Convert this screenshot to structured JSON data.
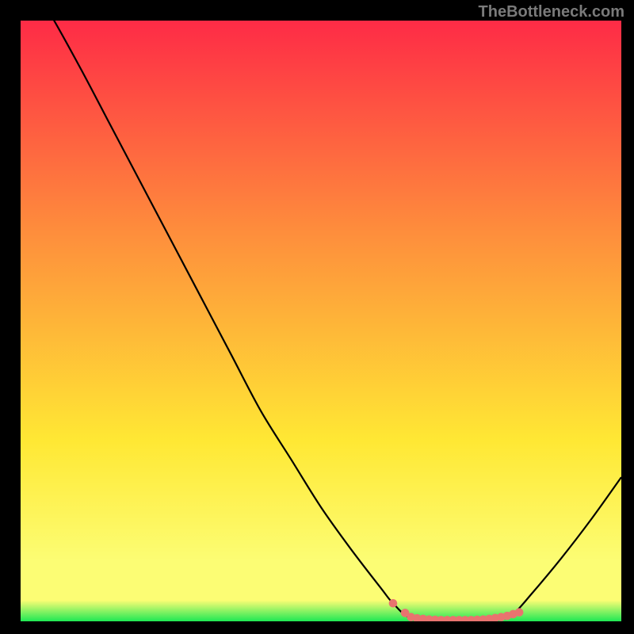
{
  "watermark": "TheBottleneck.com",
  "chart_data": {
    "type": "line",
    "title": "",
    "xlabel": "",
    "ylabel": "",
    "xlim": [
      0,
      100
    ],
    "ylim": [
      0,
      100
    ],
    "grid": false,
    "series": [
      {
        "name": "curve",
        "x": [
          0,
          5,
          10,
          15,
          20,
          25,
          30,
          35,
          40,
          45,
          50,
          55,
          60,
          62,
          65,
          70,
          75,
          80,
          82,
          85,
          90,
          95,
          100
        ],
        "y": [
          109,
          101,
          92,
          82.5,
          73,
          63.5,
          54,
          44.5,
          35,
          27,
          19,
          12,
          5.5,
          3,
          0.5,
          0.2,
          0.2,
          0.5,
          1.2,
          4.5,
          10.5,
          17,
          24
        ]
      }
    ],
    "markers": {
      "name": "optimal-band",
      "x": [
        62,
        64,
        65,
        66,
        67,
        68,
        69,
        70,
        71,
        72,
        73,
        74,
        75,
        76,
        77,
        78,
        79,
        80,
        81,
        82,
        83
      ],
      "y": [
        3,
        1.4,
        0.7,
        0.5,
        0.4,
        0.3,
        0.25,
        0.2,
        0.2,
        0.2,
        0.2,
        0.2,
        0.2,
        0.25,
        0.3,
        0.4,
        0.55,
        0.7,
        0.9,
        1.2,
        1.5
      ]
    }
  },
  "colors": {
    "gradient_top": "#fe2b46",
    "gradient_mid1": "#fe8d3c",
    "gradient_mid2": "#ffe834",
    "gradient_mid3": "#fcfd74",
    "gradient_bottom": "#1ee854",
    "curve": "#000000",
    "marker": "#e9736f"
  }
}
